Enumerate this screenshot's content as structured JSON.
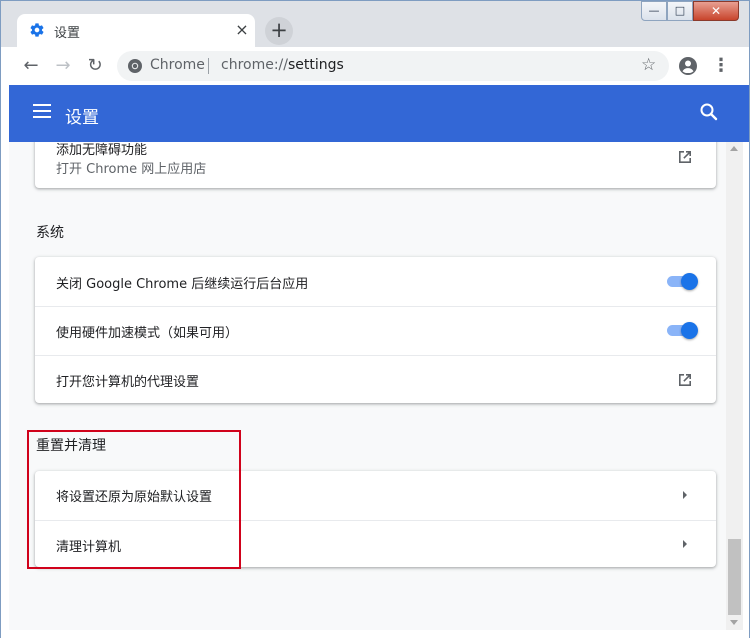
{
  "window": {
    "controls": {
      "minimize": "—",
      "maximize": "□",
      "close": "✕"
    }
  },
  "tab": {
    "title": "设置",
    "icon": "gear-icon",
    "close": "×"
  },
  "new_tab": "+",
  "toolbar": {
    "back": "←",
    "forward": "→",
    "reload": "↻",
    "site_name": "Chrome",
    "url_scheme": "chrome://",
    "url_path": "settings",
    "star": "☆",
    "menu": "⋮"
  },
  "settings_header": {
    "title": "设置"
  },
  "sections": {
    "accessibility": {
      "title": "添加无障碍功能",
      "subtitle": "打开 Chrome 网上应用店"
    },
    "system": {
      "title": "系统",
      "items": [
        {
          "label": "关闭 Google Chrome 后继续运行后台应用",
          "control": "toggle",
          "on": true
        },
        {
          "label": "使用硬件加速模式（如果可用）",
          "control": "toggle",
          "on": true
        },
        {
          "label": "打开您计算机的代理设置",
          "control": "external-link"
        }
      ]
    },
    "reset": {
      "title": "重置并清理",
      "items": [
        {
          "label": "将设置还原为原始默认设置",
          "control": "arrow"
        },
        {
          "label": "清理计算机",
          "control": "arrow"
        }
      ]
    }
  },
  "colors": {
    "header_blue": "#3367d6",
    "toggle_blue": "#1a73e8",
    "highlight_red": "#d0021b"
  }
}
